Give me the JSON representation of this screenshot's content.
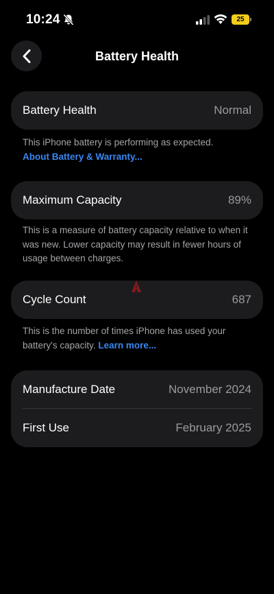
{
  "status_bar": {
    "time": "10:24",
    "battery_level": "25",
    "icons": [
      "bell-slash-icon",
      "cellular-signal-icon",
      "wifi-icon",
      "battery-icon"
    ]
  },
  "nav": {
    "back_icon": "chevron-left-icon",
    "title": "Battery Health"
  },
  "battery_health": {
    "label": "Battery Health",
    "value": "Normal",
    "description": "This iPhone battery is performing as expected.",
    "link": "About Battery & Warranty..."
  },
  "maximum_capacity": {
    "label": "Maximum Capacity",
    "value": "89%",
    "description": "This is a measure of battery capacity relative to when it was new. Lower capacity may result in fewer hours of usage between charges."
  },
  "cycle_count": {
    "label": "Cycle Count",
    "value": "687",
    "description": "This is the number of times iPhone has used your battery's capacity.",
    "link": "Learn more..."
  },
  "dates": {
    "manufacture_label": "Manufacture Date",
    "manufacture_value": "November 2024",
    "first_use_label": "First Use",
    "first_use_value": "February 2025"
  },
  "colors": {
    "background": "#000000",
    "card": "#1c1c1e",
    "secondary_text": "#9a9aa0",
    "link": "#3a87f2",
    "battery": "#f3cd1c"
  }
}
